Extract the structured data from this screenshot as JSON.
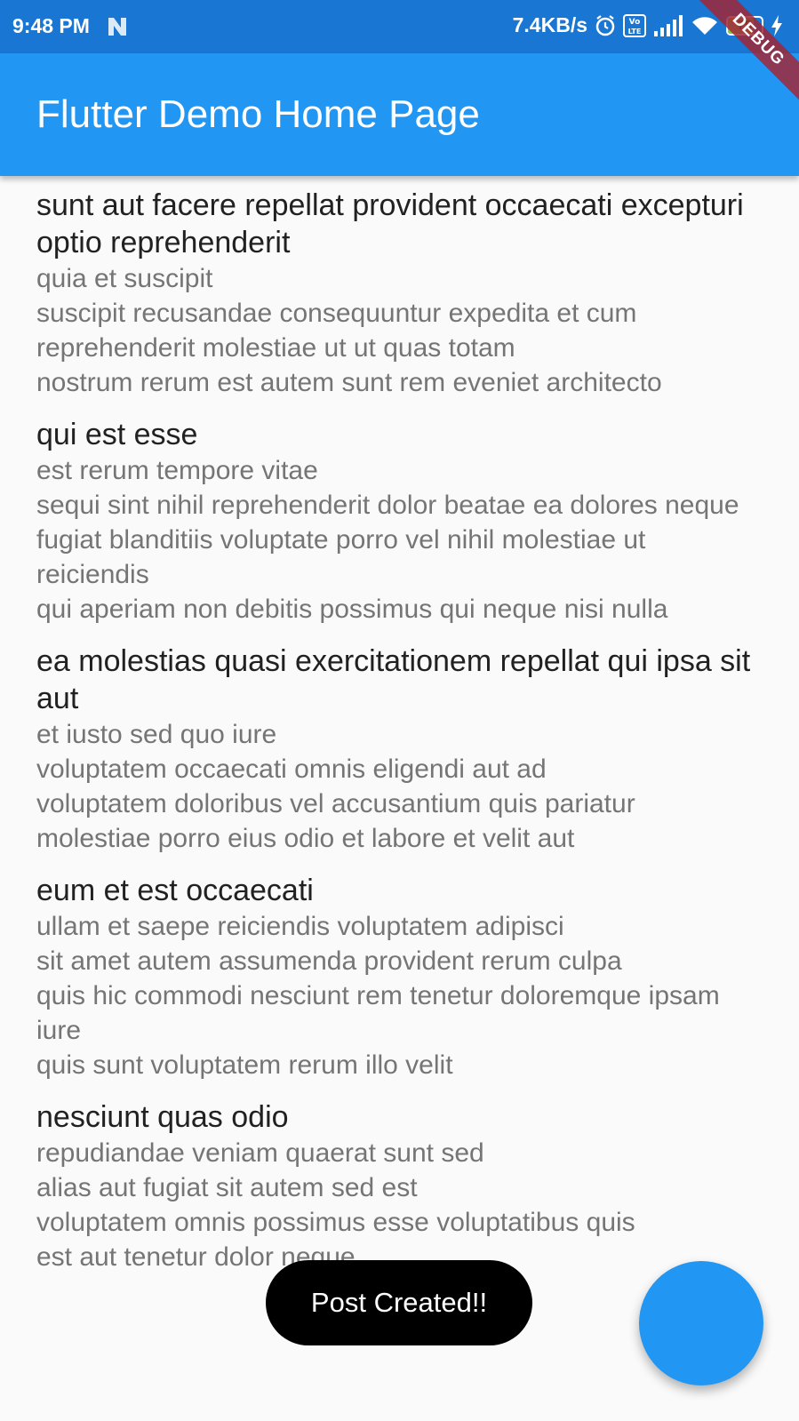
{
  "status_bar": {
    "time": "9:48 PM",
    "net_speed": "7.4KB/s",
    "battery_level": "75",
    "battery_fraction": 0.75,
    "notification_icon": "n-icon",
    "icons": [
      "alarm-icon",
      "volte-icon",
      "signal-icon",
      "wifi-icon",
      "battery-icon",
      "charging-icon"
    ]
  },
  "debug_banner": "DEBUG",
  "app_bar": {
    "title": "Flutter Demo Home Page",
    "color": "#2196f3"
  },
  "posts": [
    {
      "title": "sunt aut facere repellat provident occaecati excepturi optio reprehenderit",
      "body": [
        "quia et suscipit",
        "suscipit recusandae consequuntur expedita et cum reprehenderit molestiae ut ut quas totam",
        "nostrum rerum est autem sunt rem eveniet architecto"
      ]
    },
    {
      "title": "qui est esse",
      "body": [
        "est rerum tempore vitae",
        "sequi sint nihil reprehenderit dolor beatae ea dolores neque",
        "fugiat blanditiis voluptate porro vel nihil molestiae ut reiciendis",
        "qui aperiam non debitis possimus qui neque nisi nulla"
      ]
    },
    {
      "title": "ea molestias quasi exercitationem repellat qui ipsa sit aut",
      "body": [
        "et iusto sed quo iure",
        "voluptatem occaecati omnis eligendi aut ad",
        "voluptatem doloribus vel accusantium quis pariatur",
        "molestiae porro eius odio et labore et velit aut"
      ]
    },
    {
      "title": "eum et est occaecati",
      "body": [
        "ullam et saepe reiciendis voluptatem adipisci",
        "sit amet autem assumenda provident rerum culpa",
        "quis hic commodi nesciunt rem tenetur doloremque ipsam iure",
        "quis sunt voluptatem rerum illo velit"
      ]
    },
    {
      "title": "nesciunt quas odio",
      "body": [
        "repudiandae veniam quaerat sunt sed",
        "alias aut fugiat sit autem sed est",
        "voluptatem omnis possimus esse voluptatibus quis",
        "est aut tenetur dolor neque"
      ]
    }
  ],
  "toast": {
    "message": "Post Created!!"
  },
  "fab": {
    "color": "#2196f3"
  }
}
